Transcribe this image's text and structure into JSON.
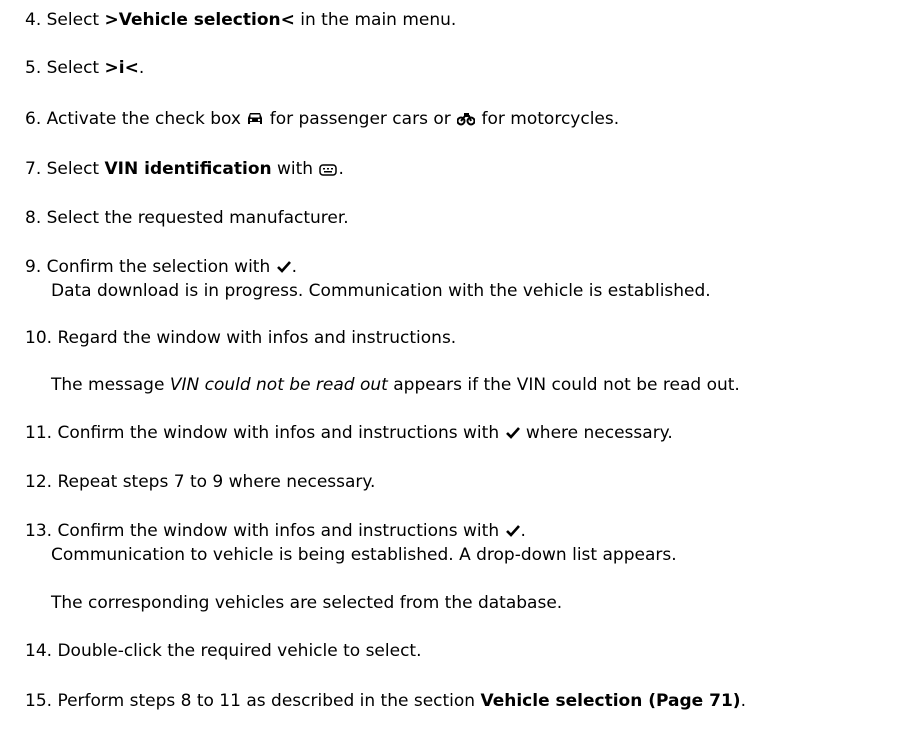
{
  "steps": [
    {
      "num": "4.",
      "t1": "Select ",
      "bold": ">Vehicle selection<",
      "t2": " in the main menu."
    },
    {
      "num": "5.",
      "t1": "Select ",
      "bold": ">i<",
      "t2": "."
    },
    {
      "num": "6.",
      "t1": "Activate the check box ",
      "icon1": "car-icon",
      "t2": " for passenger cars or ",
      "icon2": "motorcycle-icon",
      "t3": " for motorcycles."
    },
    {
      "num": "7.",
      "t1": "Select ",
      "bold": "VIN identification",
      "t2": " with ",
      "icon": "keyboard-icon",
      "t3": "."
    },
    {
      "num": "8.",
      "text": "Select the requested manufacturer."
    },
    {
      "num": "9.",
      "t1": "Confirm the selection with ",
      "icon": "checkmark-icon",
      "t2": ".",
      "sub": "Data download is in progress. Communication with the vehicle is established."
    },
    {
      "num": "10.",
      "text": "Regard the window with infos and instructions."
    },
    {
      "num": "11.",
      "t1": "Confirm the window with infos and instructions with ",
      "icon": "checkmark-icon",
      "t2": " where necessary."
    },
    {
      "num": "12.",
      "text": "Repeat steps 7 to 9 where necessary."
    },
    {
      "num": "13.",
      "t1": "Confirm the window with infos and instructions with ",
      "icon": "checkmark-icon",
      "t2": ".",
      "sub": "Communication to vehicle is being established. A drop-down list appears."
    },
    {
      "num": "14.",
      "text": "Double-click the required vehicle to select."
    },
    {
      "num": "15.",
      "t1": "Perform steps 8 to 11 as described in the section ",
      "bold": "Vehicle selection (Page 71)",
      "t2": "."
    }
  ],
  "notes": {
    "vin_msg_pre": "The message ",
    "vin_msg_italic": "VIN could not be read out",
    "vin_msg_post": " appears if the VIN could not be read out.",
    "database": "The corresponding vehicles are selected from the database."
  }
}
